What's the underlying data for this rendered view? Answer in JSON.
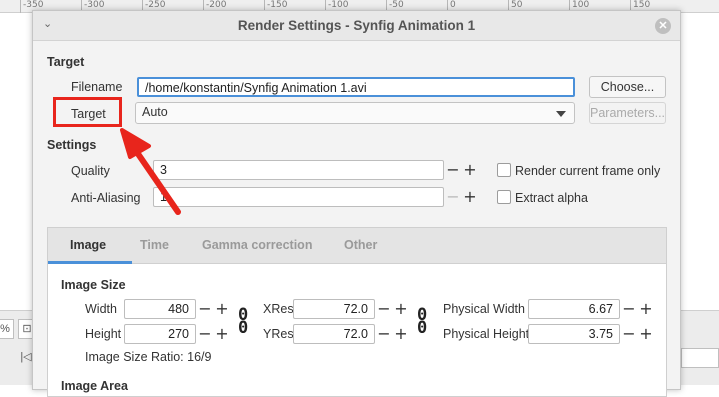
{
  "ruler": {
    "ticks": [
      "-350",
      "-300",
      "-250",
      "-200",
      "-150",
      "-100",
      "-50",
      "0",
      "50",
      "100",
      "150"
    ]
  },
  "background": {
    "cell_a": "%",
    "cell_b": "⊡",
    "cell_c": "|◁"
  },
  "dialog": {
    "title": "Render Settings - Synfig Animation 1",
    "close_glyph": "✕",
    "collapse_glyph": "⌄"
  },
  "target_section": {
    "heading": "Target",
    "filename_label": "Filename",
    "filename_value": "/home/konstantin/Synfig Animation 1.avi",
    "choose_button": "Choose...",
    "target_label": "Target",
    "target_value": "Auto",
    "parameters_button": "Parameters..."
  },
  "settings_section": {
    "heading": "Settings",
    "quality_label": "Quality",
    "quality_value": "3",
    "antialiasing_label": "Anti-Aliasing",
    "antialiasing_value": "1",
    "render_current_frame_label": "Render current frame only",
    "render_current_frame_checked": false,
    "extract_alpha_label": "Extract alpha",
    "extract_alpha_checked": false
  },
  "tabs": {
    "items": [
      "Image",
      "Time",
      "Gamma correction",
      "Other"
    ],
    "active": "Image"
  },
  "image_size": {
    "heading": "Image Size",
    "width_label": "Width",
    "width_value": "480",
    "height_label": "Height",
    "height_value": "270",
    "xres_label": "XRes",
    "xres_value": "72.0",
    "yres_label": "YRes",
    "yres_value": "72.0",
    "phys_width_label": "Physical Width",
    "phys_width_value": "6.67",
    "phys_height_label": "Physical Height",
    "phys_height_value": "3.75",
    "ratio_text": "Image Size Ratio: 16/9"
  },
  "image_area": {
    "heading": "Image Area"
  },
  "colors": {
    "accent": "#4a90d9",
    "annotation": "#e8251c"
  }
}
